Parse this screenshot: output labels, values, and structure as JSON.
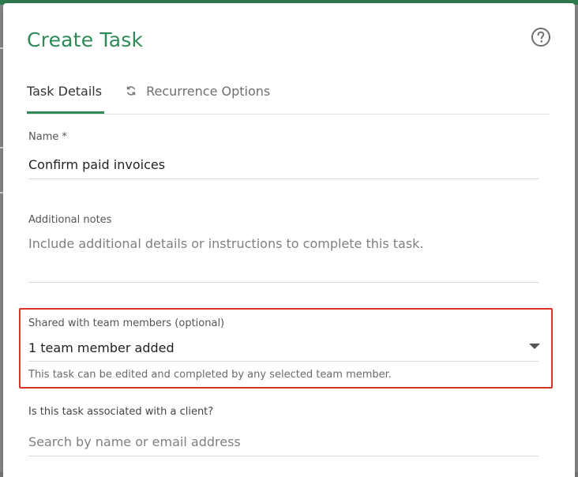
{
  "dialog": {
    "title": "Create Task",
    "help_icon": "help-circle-icon"
  },
  "tabs": [
    {
      "label": "Task Details",
      "active": true
    },
    {
      "label": "Recurrence Options",
      "active": false,
      "icon": "refresh-icon"
    }
  ],
  "fields": {
    "name": {
      "label": "Name *",
      "value": "Confirm paid invoices"
    },
    "notes": {
      "label": "Additional notes",
      "placeholder": "Include additional details or instructions to complete this task."
    },
    "shared": {
      "label": "Shared with team members (optional)",
      "value": "1 team member added",
      "helper": "This task can be edited and completed by any selected team member."
    },
    "client": {
      "label": "Is this task associated with a client?",
      "placeholder": "Search by name or email address"
    }
  },
  "colors": {
    "accent": "#2e8b57",
    "highlight_border": "#d9342b"
  }
}
